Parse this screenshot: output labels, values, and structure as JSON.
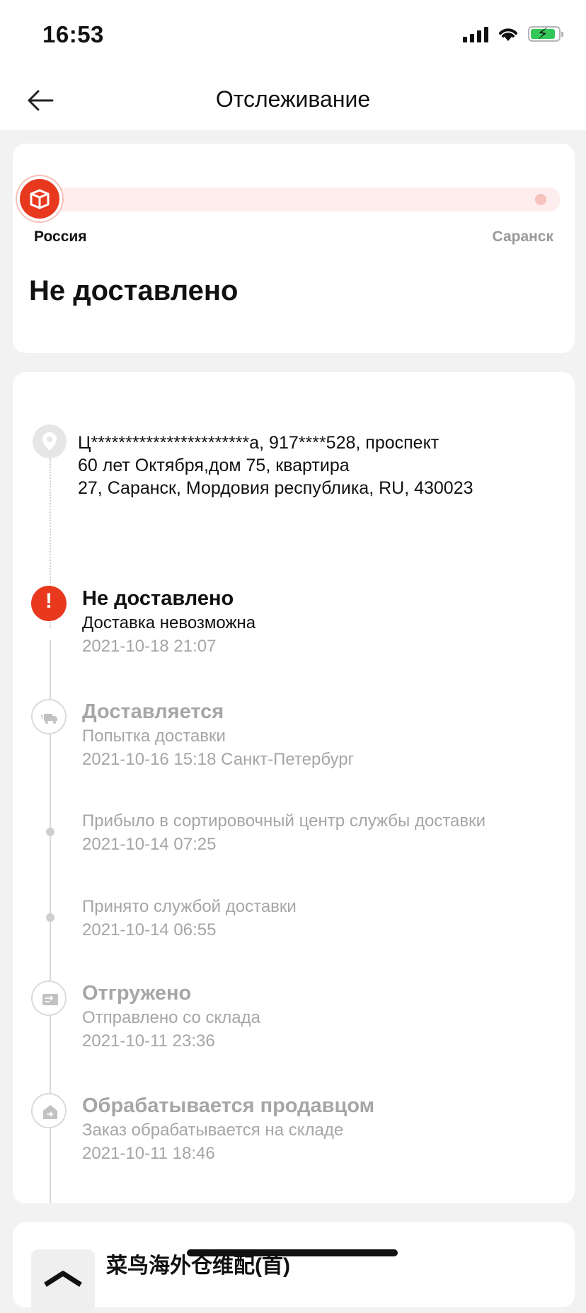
{
  "status_bar": {
    "time": "16:53"
  },
  "nav": {
    "title": "Отслеживание"
  },
  "progress": {
    "origin": "Россия",
    "destination": "Саранск",
    "status": "Не доставлено"
  },
  "address": {
    "line1": "Ц***********************а,  917****528,  проспект",
    "line2": "60 лет Октября,дом 75, квартира",
    "line3": "27,  Саранск,  Мордовия республика,  RU,  430023"
  },
  "events": [
    {
      "icon": "alert-icon",
      "title": "Не доставлено",
      "desc": "Доставка невозможна",
      "time": "2021-10-18 21:07"
    },
    {
      "icon": "truck-icon",
      "title": "Доставляется",
      "desc": "Попытка доставки",
      "time": "2021-10-16 15:18 Санкт-Петербург"
    },
    {
      "icon": "dot",
      "title": "",
      "desc": "Прибыло в сортировочный центр службы доставки",
      "time": "2021-10-14 07:25"
    },
    {
      "icon": "dot",
      "title": "",
      "desc": "Принято службой доставки",
      "time": "2021-10-14 06:55"
    },
    {
      "icon": "shipped-icon",
      "title": "Отгружено",
      "desc": "Отправлено со склада",
      "time": "2021-10-11 23:36"
    },
    {
      "icon": "warehouse-icon",
      "title": "Обрабатывается продавцом",
      "desc": "Заказ обрабатывается на складе",
      "time": "2021-10-11 18:46"
    }
  ],
  "carrier": {
    "name": "菜鸟海外仓维配(首)"
  },
  "colors": {
    "accent": "#e8391f",
    "muted": "#a6a6a6"
  }
}
